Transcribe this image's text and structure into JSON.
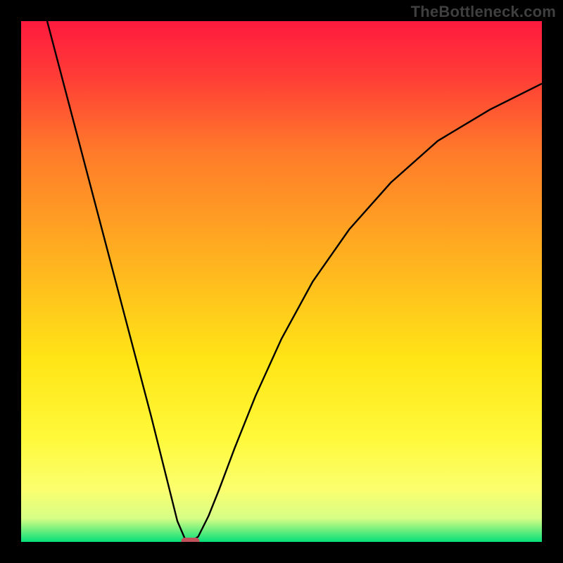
{
  "watermark": "TheBottleneck.com",
  "chart_data": {
    "type": "line",
    "title": "",
    "xlabel": "",
    "ylabel": "",
    "xlim": [
      0,
      100
    ],
    "ylim": [
      0,
      100
    ],
    "grid": false,
    "background": {
      "gradient_stops": [
        {
          "offset": 0.0,
          "color": "#ff1a3f"
        },
        {
          "offset": 0.1,
          "color": "#ff3a37"
        },
        {
          "offset": 0.25,
          "color": "#ff7a2a"
        },
        {
          "offset": 0.45,
          "color": "#ffb020"
        },
        {
          "offset": 0.65,
          "color": "#ffe516"
        },
        {
          "offset": 0.8,
          "color": "#fff93a"
        },
        {
          "offset": 0.9,
          "color": "#fbff6f"
        },
        {
          "offset": 0.955,
          "color": "#d6fe86"
        },
        {
          "offset": 0.975,
          "color": "#7af07e"
        },
        {
          "offset": 1.0,
          "color": "#05e07a"
        }
      ]
    },
    "series": [
      {
        "name": "curve-left",
        "x": [
          5,
          10,
          15,
          20,
          25,
          28,
          30,
          31.5,
          32.5
        ],
        "y": [
          100,
          81,
          62,
          43,
          24,
          12,
          4,
          0.5,
          0
        ]
      },
      {
        "name": "curve-right",
        "x": [
          32.5,
          34,
          36,
          38,
          41,
          45,
          50,
          56,
          63,
          71,
          80,
          90,
          100
        ],
        "y": [
          0,
          1,
          5,
          10,
          18,
          28,
          39,
          50,
          60,
          69,
          77,
          83,
          88
        ]
      }
    ],
    "min_marker": {
      "x": 32.5,
      "y": 0,
      "color": "#c0505a"
    }
  }
}
